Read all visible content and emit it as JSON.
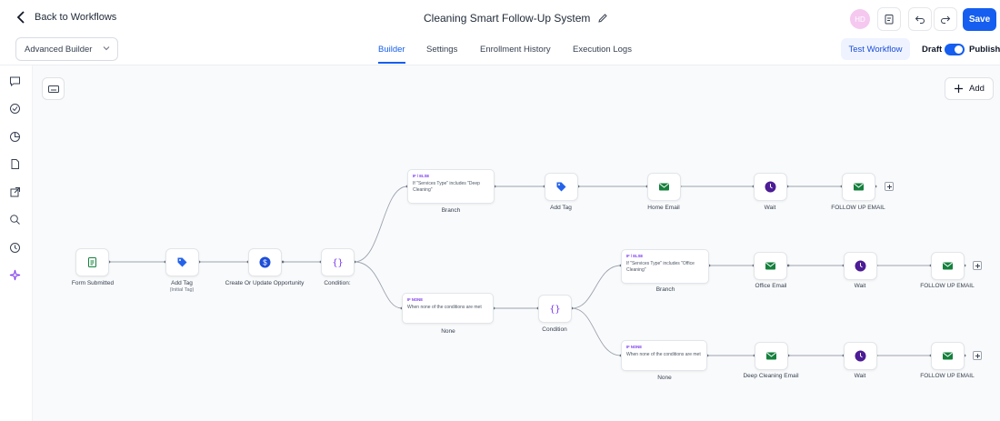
{
  "header": {
    "back_label": "Back to Workflows",
    "workflow_title": "Cleaning Smart Follow-Up System",
    "avatar_initials": "HD",
    "save_label": "Save"
  },
  "subbar": {
    "builder_select": "Advanced Builder",
    "tabs": [
      "Builder",
      "Settings",
      "Enrollment History",
      "Execution Logs"
    ],
    "active_tab": "Builder",
    "test_workflow": "Test Workflow",
    "draft_label": "Draft",
    "publish_label": "Publish",
    "published": true
  },
  "canvas": {
    "add_label": "Add",
    "nodes": {
      "form_submitted": "Form Submitted",
      "add_tag_main": "Add Tag",
      "add_tag_sub": "(Initial Tag)",
      "create_opportunity": "Create Or Update Opportunity",
      "condition1": "Condition:",
      "branch1_badge": "IF / ELSE",
      "branch1_cond": "If \"Services Type\" includes \"Deep Cleaning\"",
      "branch1_label": "Branch",
      "add_tag2": "Add Tag",
      "home_email": "Home Email",
      "wait1": "Wait",
      "follow_up1": "FOLLOW UP EMAIL",
      "none1_badge": "IF NONE",
      "none1_cond": "When none of the conditions are met",
      "none1_label": "None",
      "condition2": "Condition",
      "branch2_badge": "IF / ELSE",
      "branch2_cond": "If \"Services Type\" includes \"Office Cleaning\"",
      "branch2_label": "Branch",
      "office_email": "Office Email",
      "wait2": "Wait",
      "follow_up2": "FOLLOW UP EMAIL",
      "none2_badge": "IF NONE",
      "none2_cond": "When none of the conditions are met",
      "none2_label": "None",
      "deep_email": "Deep Cleaning Email",
      "wait3": "Wait",
      "follow_up3": "FOLLOW UP EMAIL"
    }
  },
  "colors": {
    "primary": "#155eef",
    "condition_purple": "#7c3aed",
    "email_green": "#16a34a",
    "tag_blue": "#2563eb",
    "wait_purple": "#5b21b6",
    "form_green": "#15803d"
  }
}
